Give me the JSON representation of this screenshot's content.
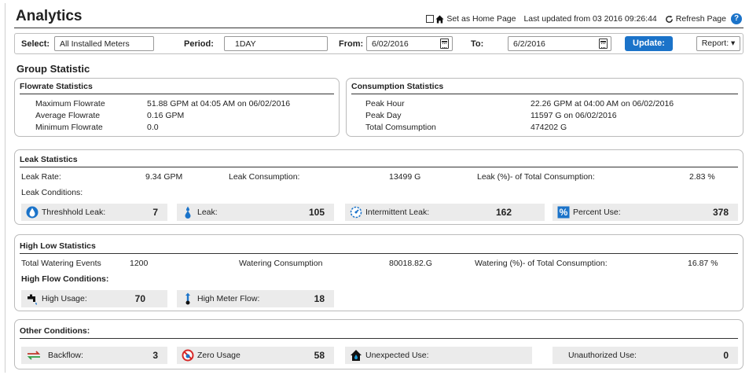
{
  "header": {
    "title": "Analytics",
    "set_home": "Set as Home Page",
    "last_updated": "Last updated from 03 2016 09:26:44",
    "refresh": "Refresh Page",
    "help": "?"
  },
  "filter": {
    "select_label": "Select:",
    "select_value": "All Installed Meters",
    "period_label": "Period:",
    "period_value": "1DAY",
    "from_label": "From:",
    "from_value": "6/02/2016",
    "to_label": "To:",
    "to_value": "6/2/2016",
    "update": "Update:",
    "report": "Report: ▾"
  },
  "group_title": "Group Statistic",
  "flowrate": {
    "title": "Flowrate Statistics",
    "rows": [
      {
        "label": "Maximum Flowrate",
        "value": "51.88 GPM at 04:05 AM on 06/02/2016"
      },
      {
        "label": "Average Flowrate",
        "value": "0.16 GPM"
      },
      {
        "label": "Minimum Flowrate",
        "value": "0.0"
      }
    ]
  },
  "consumption": {
    "title": "Consumption Statistics",
    "rows": [
      {
        "label": "Peak Hour",
        "value": "22.26 GPM at 04:00 AM on 06/02/2016"
      },
      {
        "label": "Peak Day",
        "value": "11597 G on 06/02/2016"
      },
      {
        "label": "Total Comsumption",
        "value": "474202 G"
      }
    ]
  },
  "leak": {
    "title": "Leak Statistics",
    "rate_label": "Leak Rate:",
    "rate_value": "9.34 GPM",
    "consumption_label": "Leak Consumption:",
    "consumption_value": "13499 G",
    "pct_label": "Leak (%)- of Total Consumption:",
    "pct_value": "2.83 %",
    "conditions_label": "Leak Conditions:",
    "tiles": [
      {
        "label": "Threshhold Leak:",
        "value": "7",
        "icon": "water-drop-icon"
      },
      {
        "label": "Leak:",
        "value": "105",
        "icon": "drip-icon"
      },
      {
        "label": "Intermittent Leak:",
        "value": "162",
        "icon": "intermittent-gauge-icon"
      },
      {
        "label": "Percent Use:",
        "value": "378",
        "icon": "percent-icon"
      }
    ]
  },
  "highlow": {
    "title": "High Low  Statistics",
    "events_label": "Total Watering Events",
    "events_value": "1200",
    "consumption_label": "Watering Consumption",
    "consumption_value": "80018.82.G",
    "pct_label": "Watering (%)- of Total Consumption:",
    "pct_value": "16.87 %",
    "conditions_label": "High Flow Conditions:",
    "tiles": [
      {
        "label": "High Usage:",
        "value": "70",
        "icon": "faucet-icon"
      },
      {
        "label": "High Meter Flow:",
        "value": "18",
        "icon": "thermometer-up-icon"
      }
    ]
  },
  "other": {
    "title": "Other Conditions:",
    "tiles": [
      {
        "label": "Backflow:",
        "value": "3",
        "icon": "backflow-arrows-icon"
      },
      {
        "label": "Zero Usage",
        "value": "58",
        "icon": "no-entry-icon"
      },
      {
        "label": "Unexpected Use:",
        "value": "",
        "icon": "house-icon"
      },
      {
        "label": "Unauthorized Use:",
        "value": "0",
        "icon": ""
      }
    ]
  },
  "colors": {
    "accent": "#1b73c9",
    "tile_bg": "#ebebeb"
  }
}
